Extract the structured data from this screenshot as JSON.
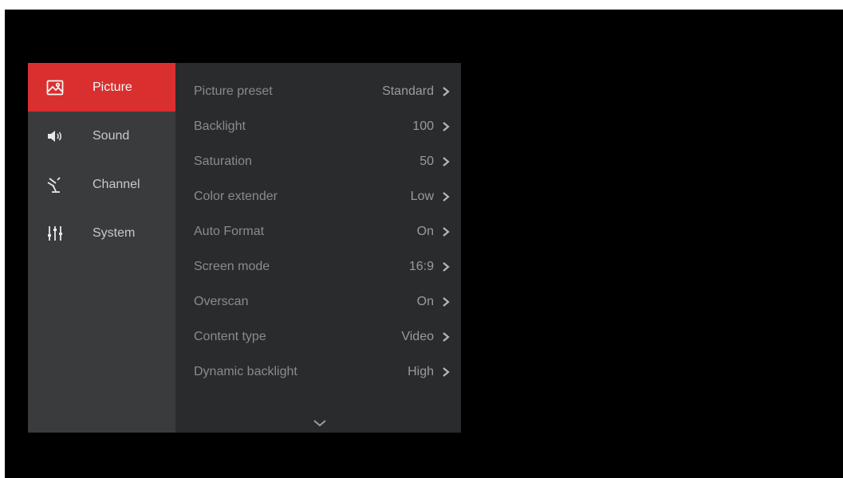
{
  "sidebar": {
    "items": [
      {
        "label": "Picture",
        "icon": "picture-icon",
        "active": true
      },
      {
        "label": "Sound",
        "icon": "speaker-icon",
        "active": false
      },
      {
        "label": "Channel",
        "icon": "antenna-icon",
        "active": false
      },
      {
        "label": "System",
        "icon": "sliders-icon",
        "active": false
      }
    ]
  },
  "settings": [
    {
      "label": "Picture preset",
      "value": "Standard"
    },
    {
      "label": "Backlight",
      "value": "100"
    },
    {
      "label": "Saturation",
      "value": "50"
    },
    {
      "label": "Color extender",
      "value": "Low"
    },
    {
      "label": "Auto Format",
      "value": "On"
    },
    {
      "label": "Screen mode",
      "value": "16:9"
    },
    {
      "label": "Overscan",
      "value": "On"
    },
    {
      "label": "Content type",
      "value": "Video"
    },
    {
      "label": "Dynamic backlight",
      "value": "High"
    }
  ],
  "colors": {
    "accent": "#d9302f",
    "sidebar_bg": "#3a3b3d",
    "panel_bg": "#2a2b2d",
    "screen_bg": "#000000"
  },
  "scroll_icon": "chevron-down-icon"
}
